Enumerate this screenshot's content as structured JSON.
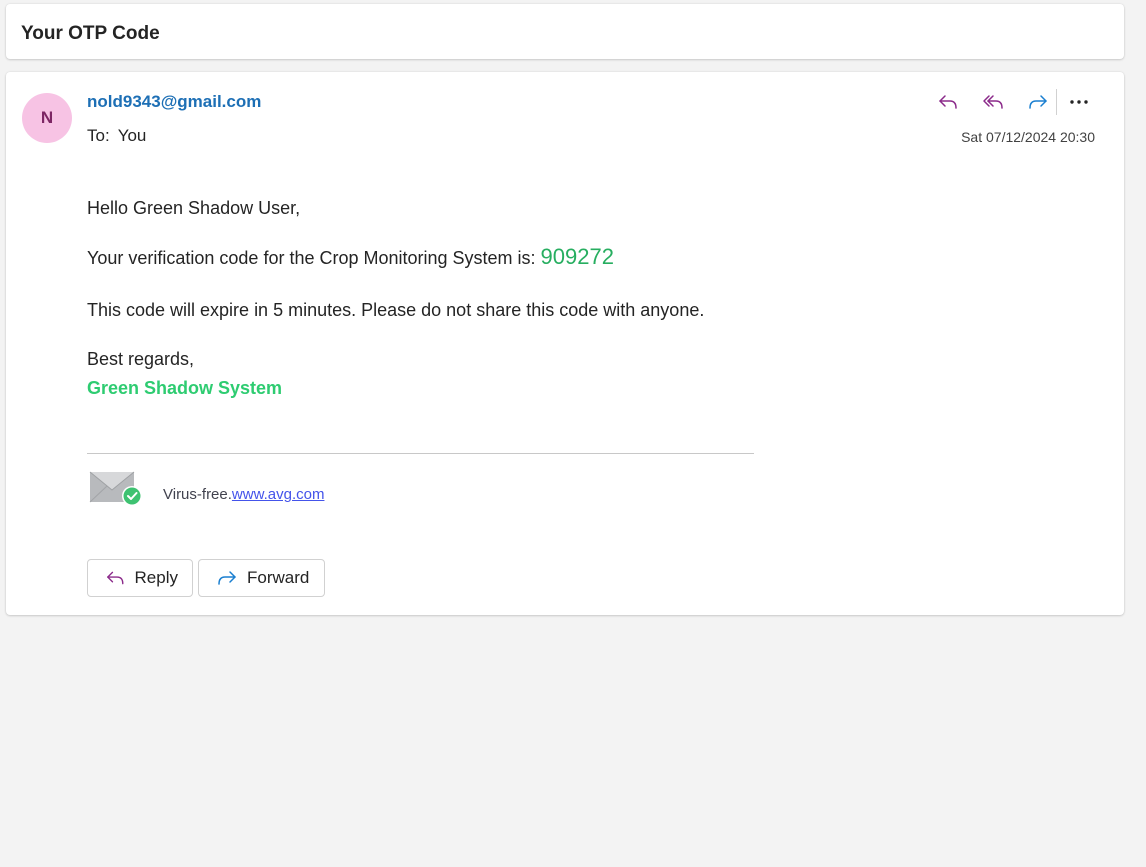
{
  "subject": "Your OTP Code",
  "message": {
    "avatar_initial": "N",
    "sender": "nold9343@gmail.com",
    "to_label": "To:",
    "to_value": "You",
    "timestamp": "Sat 07/12/2024 20:30",
    "actions": {
      "reply_icon": "reply-icon",
      "reply_all_icon": "reply-all-icon",
      "forward_icon": "forward-icon",
      "more_icon": "more-options-icon"
    }
  },
  "body": {
    "greeting": "Hello Green Shadow User,",
    "code_intro": "Your verification code for the Crop Monitoring System is: ",
    "code": "909272",
    "expiry_note": "This code will expire in 5 minutes. Please do not share this code with anyone.",
    "closing": "Best regards,",
    "signature": "Green Shadow System"
  },
  "footer": {
    "virus_free_label": "Virus-free.",
    "avg_link": "www.avg.com"
  },
  "buttons": {
    "reply": "Reply",
    "forward": "Forward"
  },
  "colors": {
    "otp_code": "#27ae60",
    "signature": "#2ecc71",
    "sender": "#1d6fb5",
    "avatar_bg": "#f7c3e4",
    "reply_icon": "#8b2a8a",
    "forward_icon": "#1a7fd0",
    "link": "#4453ea"
  }
}
